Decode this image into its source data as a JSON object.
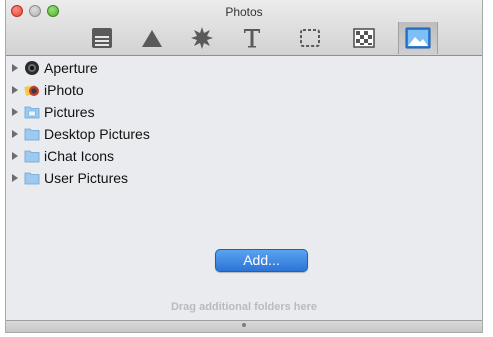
{
  "window": {
    "title": "Photos",
    "toolbar": [
      {
        "icon": "display-icon"
      },
      {
        "icon": "triangle-icon"
      },
      {
        "icon": "starburst-icon"
      },
      {
        "icon": "text-icon"
      },
      {
        "icon": "marquee-icon"
      },
      {
        "icon": "checkerboard-icon"
      },
      {
        "icon": "photo-icon",
        "selected": true
      }
    ]
  },
  "sources": [
    {
      "label": "Aperture",
      "icon": "aperture-icon"
    },
    {
      "label": "iPhoto",
      "icon": "iphoto-icon"
    },
    {
      "label": "Pictures",
      "icon": "pictures-folder-icon"
    },
    {
      "label": "Desktop Pictures",
      "icon": "folder-icon"
    },
    {
      "label": "iChat Icons",
      "icon": "folder-icon"
    },
    {
      "label": "User Pictures",
      "icon": "folder-icon"
    }
  ],
  "add_button": {
    "label": "Add..."
  },
  "drop_hint": "Drag additional folders here",
  "colors": {
    "accent": "#2c74d6",
    "close": "#e0443a",
    "zoom": "#4fae2e"
  }
}
